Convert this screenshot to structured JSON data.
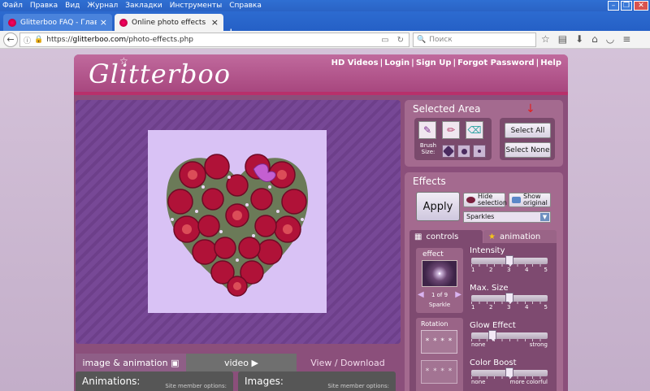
{
  "browser": {
    "menu": [
      "Файл",
      "Правка",
      "Вид",
      "Журнал",
      "Закладки",
      "Инструменты",
      "Справка"
    ],
    "tabs": [
      {
        "label": "Glitterboo FAQ - Главная / П..."
      },
      {
        "label": "Online photo effects editor"
      }
    ],
    "url": {
      "scheme": "https://",
      "host": "glitterboo.com",
      "path": "/photo-effects.php"
    },
    "search_placeholder": "Поиск"
  },
  "site": {
    "logo": "Glitterboo",
    "toplinks": [
      "HD Videos",
      "Login",
      "Sign Up",
      "Forgot Password",
      "Help"
    ],
    "bottom_tabs": [
      "image & animation",
      "video",
      "View / Download"
    ],
    "bottom_panels": [
      {
        "title": "Animations:",
        "sub": "Site member options:"
      },
      {
        "title": "Images:",
        "sub": "Site member options:"
      }
    ],
    "selected_area": {
      "title": "Selected Area",
      "brush_size_label": "Brush Size:",
      "select_all": "Select All",
      "select_none": "Select None"
    },
    "effects": {
      "title": "Effects",
      "apply": "Apply",
      "hide_selection": "Hide selection",
      "show_original": "Show original",
      "selected_effect": "Sparkles",
      "tabs": [
        "controls",
        "animation"
      ],
      "effect_label": "effect",
      "pager": "1 of 9",
      "effect_name": "Sparkle",
      "rotation_label": "Rotation",
      "rotation_thumb": "* * * *",
      "sliders": [
        {
          "label": "Intensity",
          "scale": [
            "1",
            "2",
            "3",
            "4",
            "5"
          ],
          "value": 3,
          "min": 1,
          "max": 5
        },
        {
          "label": "Max. Size",
          "scale": [
            "1",
            "2",
            "3",
            "4",
            "5"
          ],
          "value": 3,
          "min": 1,
          "max": 5
        },
        {
          "label": "Glow Effect",
          "scale": [
            "none",
            "strong"
          ],
          "value": 0.25,
          "min": 0,
          "max": 1
        },
        {
          "label": "Color Boost",
          "scale": [
            "none",
            "more colorful"
          ],
          "value": 0.5,
          "min": 0,
          "max": 1
        }
      ]
    }
  },
  "colors": {
    "accent": "#b8306b",
    "panel": "#a46a8f"
  }
}
